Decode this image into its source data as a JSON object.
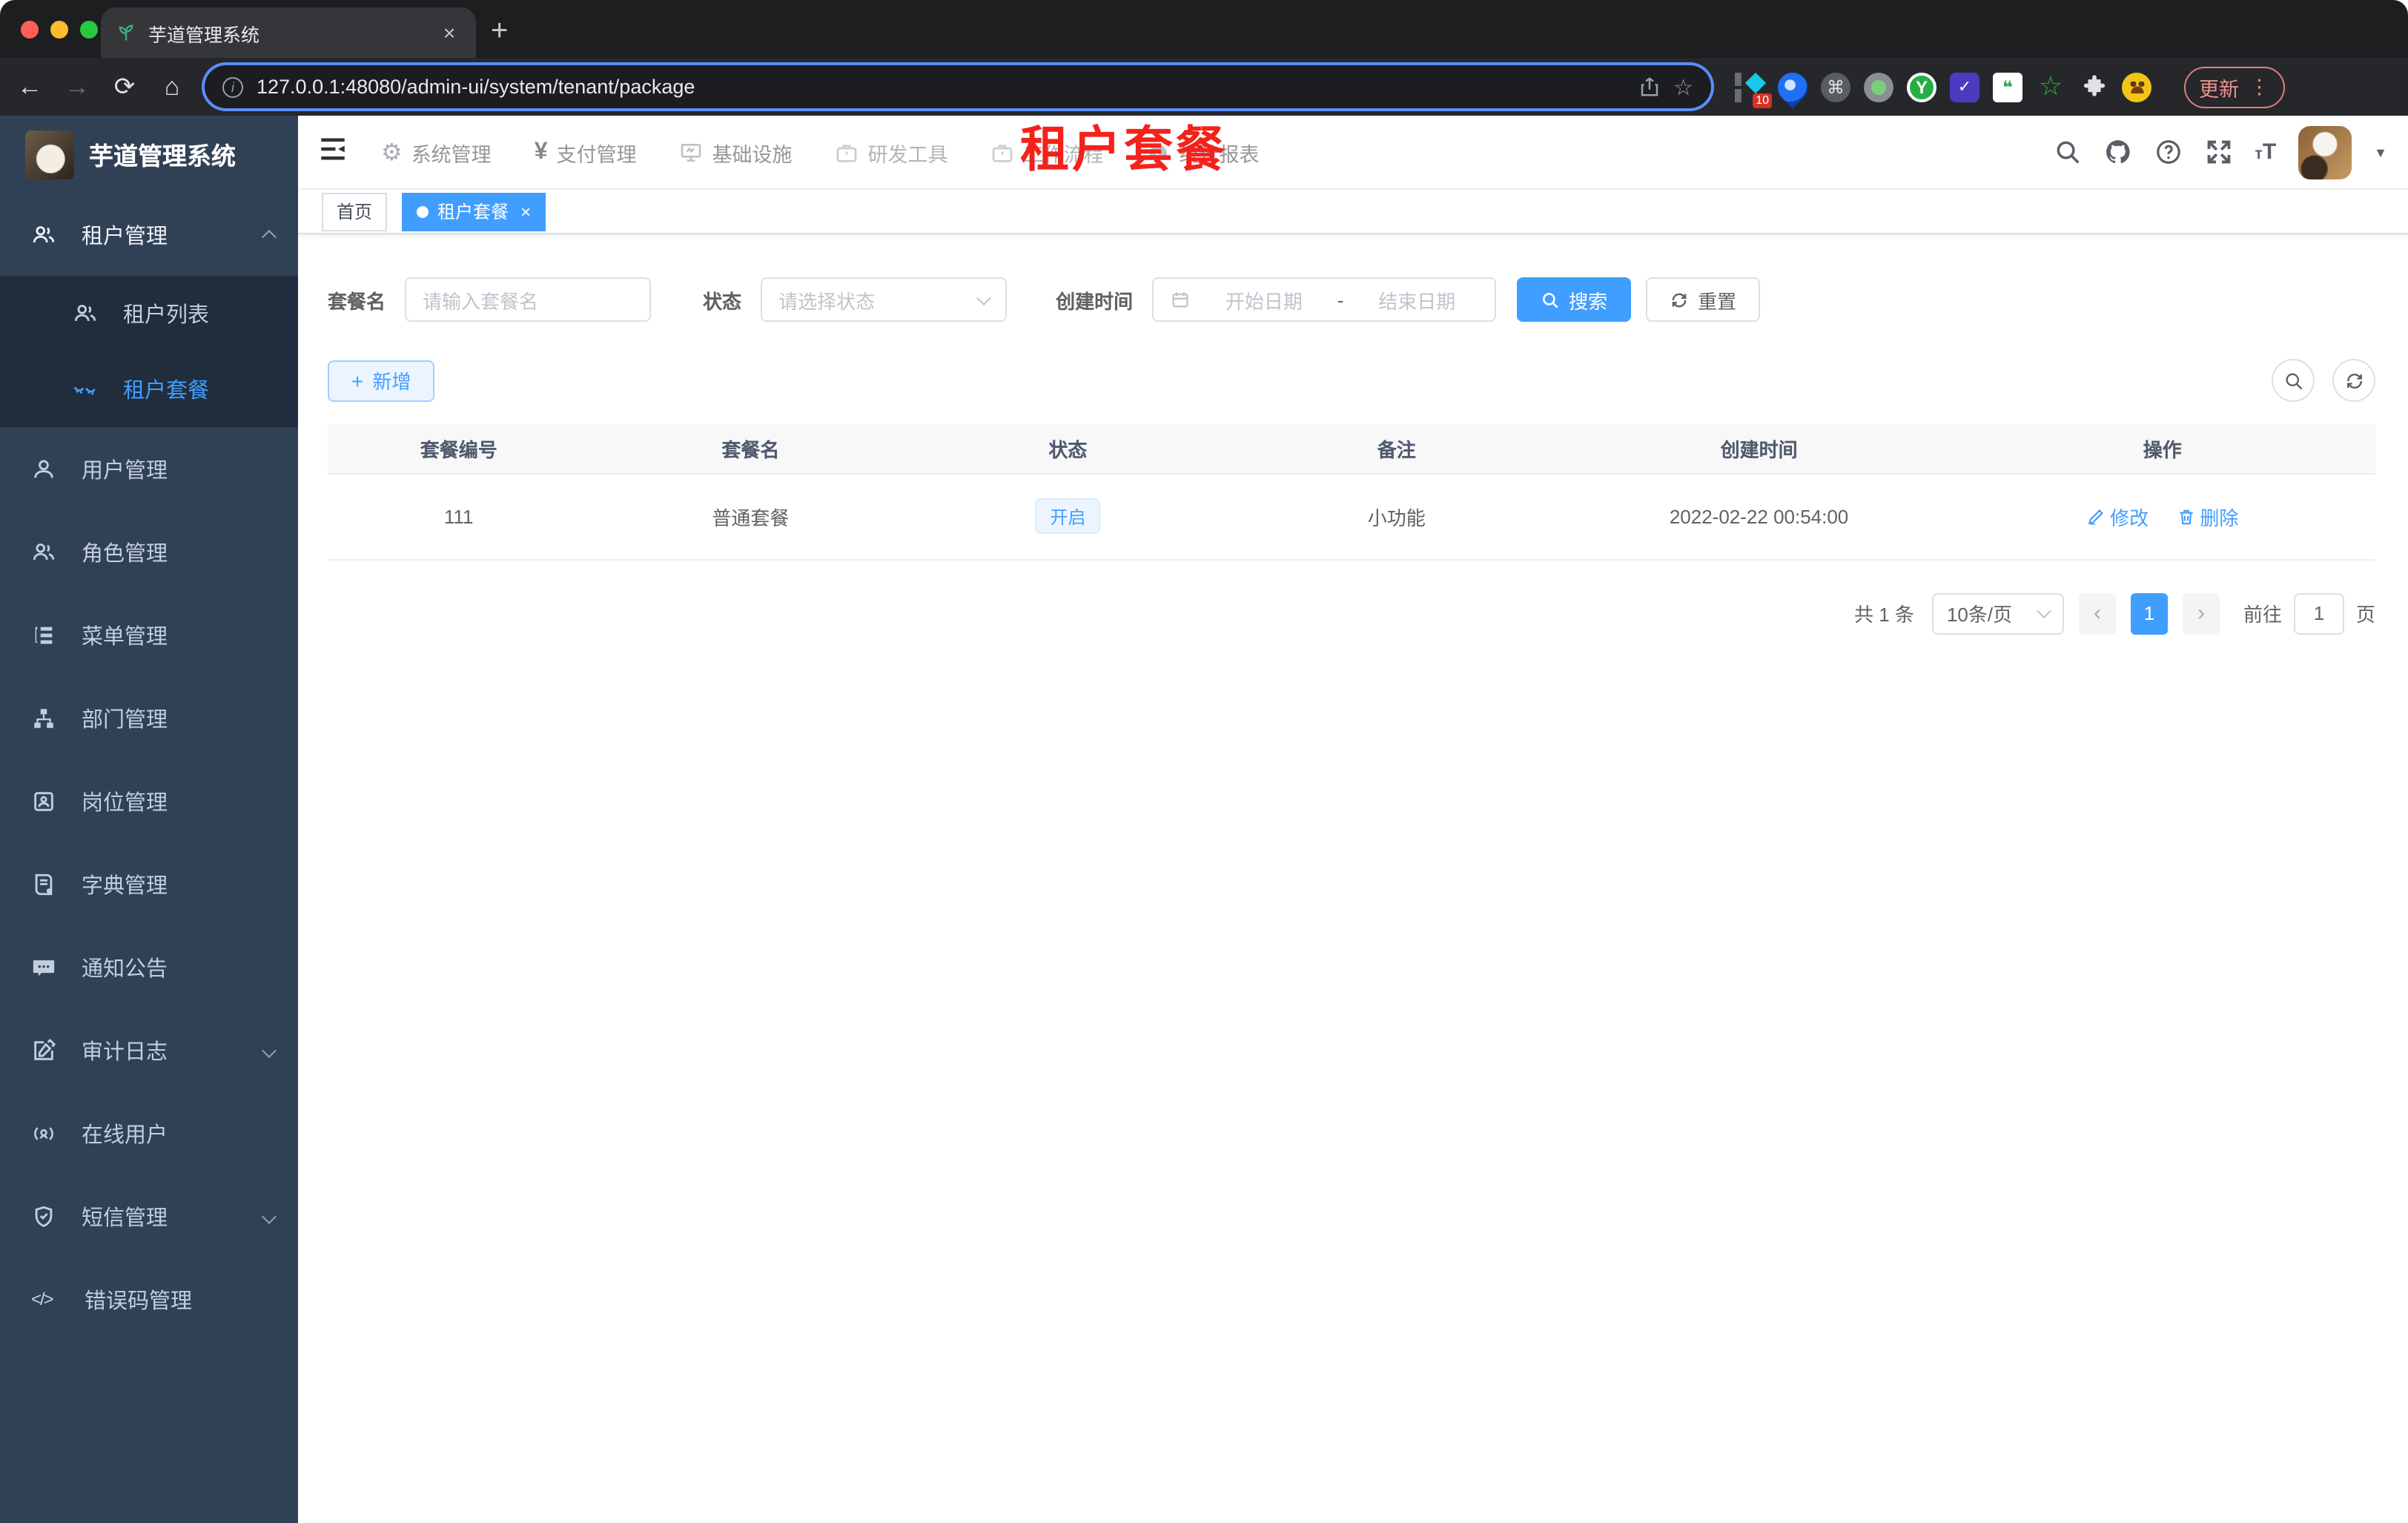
{
  "browser": {
    "tab_title": "芋道管理系统",
    "url": "127.0.0.1:48080/admin-ui/system/tenant/package",
    "update_label": "更新",
    "extension_badge": "10"
  },
  "icons": {
    "close": "×",
    "newtab": "+",
    "back": "←",
    "forward": "→",
    "reload": "⟳",
    "home": "⌂",
    "share": "⇧",
    "star": "☆",
    "dots": "⋮",
    "command": "⌘",
    "y_letter": "Y",
    "shield": "✓",
    "chat": "❝",
    "star_green": "☆",
    "caret": "▼",
    "gear": "⚙",
    "yen": "¥",
    "code": "</>",
    "plus": "+",
    "prev": "‹",
    "next": "›",
    "info": "i",
    "font_small": "т",
    "font_big": "T"
  },
  "topnav": {
    "items": [
      {
        "label": "系统管理"
      },
      {
        "label": "支付管理"
      },
      {
        "label": "基础设施"
      },
      {
        "label": "研发工具"
      },
      {
        "label": "工作流程"
      },
      {
        "label": "统计报表"
      }
    ]
  },
  "sidebar": {
    "title": "芋道管理系统",
    "items": [
      {
        "label": "租户管理"
      },
      {
        "label": "租户列表"
      },
      {
        "label": "租户套餐"
      },
      {
        "label": "用户管理"
      },
      {
        "label": "角色管理"
      },
      {
        "label": "菜单管理"
      },
      {
        "label": "部门管理"
      },
      {
        "label": "岗位管理"
      },
      {
        "label": "字典管理"
      },
      {
        "label": "通知公告"
      },
      {
        "label": "审计日志"
      },
      {
        "label": "在线用户"
      },
      {
        "label": "短信管理"
      },
      {
        "label": "错误码管理"
      }
    ]
  },
  "tags": {
    "home": "首页",
    "active": "租户套餐"
  },
  "page": {
    "watermark": "租户套餐"
  },
  "filters": {
    "name_label": "套餐名",
    "name_placeholder": "请输入套餐名",
    "status_label": "状态",
    "status_placeholder": "请选择状态",
    "time_label": "创建时间",
    "start_placeholder": "开始日期",
    "range_separator": "-",
    "end_placeholder": "结束日期",
    "search_label": "搜索",
    "reset_label": "重置"
  },
  "toolbar": {
    "add_label": "新增"
  },
  "table": {
    "headers": [
      "套餐编号",
      "套餐名",
      "状态",
      "备注",
      "创建时间",
      "操作"
    ],
    "rows": [
      {
        "id": "111",
        "name": "普通套餐",
        "status": "开启",
        "remark": "小功能",
        "created": "2022-02-22 00:54:00",
        "edit": "修改",
        "delete": "删除"
      }
    ]
  },
  "pagination": {
    "total": "共 1 条",
    "page_size": "10条/页",
    "page": "1",
    "jump_prefix": "前往",
    "jump_value": "1",
    "jump_suffix": "页"
  },
  "colors": {
    "primary": "#409eff",
    "watermark_red": "#f4221b",
    "sidebar_bg": "#304156",
    "submenu_bg": "#1f2d3d"
  }
}
